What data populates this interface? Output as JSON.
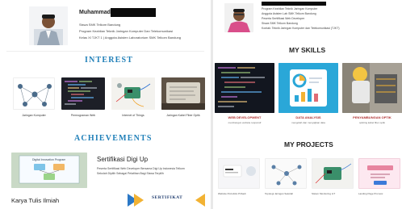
{
  "left": {
    "profile": {
      "name": "Muhammad",
      "lines": [
        "Siswa SMK Telkom Bandung",
        "Program Keahlian Teknik Jaringan Komputer Dan Telekomunikasi",
        "Kelas XI TJKT 1 | Anggota Asisten Laboratorium SMK Telkom Bandung"
      ]
    },
    "interest": {
      "heading": "INTEREST",
      "items": [
        {
          "caption": "Jaringan Komputer"
        },
        {
          "caption": "Pemrograman Web"
        },
        {
          "caption": "Internet of Things"
        },
        {
          "caption": "Jaringan Kabel Fiber Optik"
        }
      ]
    },
    "achievements": {
      "heading": "ACHIEVEMENTS",
      "title": "Sertifikasi Digi Up",
      "desc": [
        "Peserta Sertifikasi Web Developer Bersama Digi Up Indonesia Telkom",
        "Sekolah Dipilih Sebagai Pelatihan Bagi Siswa Terpilih"
      ],
      "slide_title": "Digital Innovation Program",
      "karya_title": "Karya Tulis Ilmiah",
      "cert_label": "SERTIFIKAT"
    }
  },
  "right": {
    "profile_lines": [
      "Program Keahlian Teknik Jaringan Komputer",
      "Anggota Asisten Lab SMK Telkom Bandung",
      "Peserta Sertifikasi Web Developer",
      "Siswa SMK Telkom Bandung",
      "Kontak: Teknik Jaringan Komputer dan Telekomunikasi (TJKT)"
    ],
    "skills": {
      "heading": "MY SKILLS",
      "items": [
        {
          "title": "WEB DEVELOPMENT",
          "sub": "membangun website responsif"
        },
        {
          "title": "DATA ANALYSIS",
          "sub": "mengolah dan menyajikan data"
        },
        {
          "title": "PENYAMBUNGAN OPTIK",
          "sub": "splicing kabel fiber optik"
        }
      ]
    },
    "projects": {
      "heading": "MY PROJECTS",
      "items": [
        {
          "caption": "Website Portofolio Pribadi"
        },
        {
          "caption": "Topologi Jaringan Sekolah"
        },
        {
          "caption": "Sistem Monitoring IoT"
        },
        {
          "caption": "Landing Page Promosi"
        }
      ]
    }
  },
  "colors": {
    "accent_blue": "#1f7fb8",
    "skill_red": "#b03030",
    "data_blue": "#2aa7d8",
    "divider": "#e8e8e8"
  }
}
